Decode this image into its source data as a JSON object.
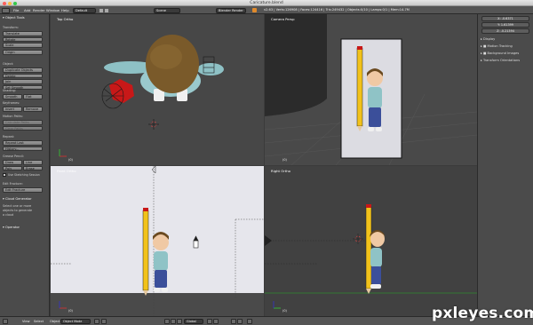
{
  "window": {
    "title": "Caricature.blend"
  },
  "info_header": {
    "menus": [
      "File",
      "Add",
      "Render",
      "Window",
      "Help"
    ],
    "layout": "Default",
    "scene": "Scene",
    "engine": "Blender Render",
    "stats": "v2.63 | Verts:126908 | Faces:124416 | Tris:249432 | Objects:0/10 | Lamps:0/1 | Mem:14.7M"
  },
  "tool_shelf": {
    "header": "Object Tools",
    "transform": {
      "title": "Transform:",
      "buttons": [
        "Translate",
        "Rotate",
        "Scale",
        "Origin"
      ]
    },
    "object": {
      "title": "Object:",
      "buttons": [
        "Duplicate Objects",
        "Delete",
        "Join",
        "Set Smooth"
      ]
    },
    "shading": {
      "title": "Shading:",
      "smooth": "Smooth",
      "flat": "Flat"
    },
    "keyframes": {
      "title": "Keyframes:",
      "insert": "Insert",
      "remove": "Remove"
    },
    "motion_paths": {
      "title": "Motion Paths:",
      "buttons": [
        "Calculate Paths",
        "Clear Paths"
      ]
    },
    "repeat": {
      "title": "Repeat:",
      "buttons": [
        "Repeat Last",
        "History..."
      ]
    },
    "grease_pencil": {
      "title": "Grease Pencil:",
      "draw": "Draw",
      "line": "Line",
      "poly": "Poly",
      "erase": "Erase",
      "checkbox": "Use Sketching Session"
    },
    "edit_fracture": {
      "title": "Edit Fracture:",
      "button": "Edit Fracture"
    },
    "cloud": {
      "title": "Cloud Generator",
      "text": [
        "Select one or more",
        "objects to generate",
        "a cloud"
      ]
    },
    "operator": "Operator"
  },
  "viewports": {
    "top_left": {
      "label": "Top Ortho",
      "num": "(0)"
    },
    "top_right": {
      "label": "Camera Persp",
      "num": "(0)"
    },
    "bottom_left": {
      "label": "Front Ortho",
      "num": "(0)"
    },
    "bottom_right": {
      "label": "Right Ortho",
      "num": "(0)"
    }
  },
  "properties": {
    "x": "X: -0.6371",
    "y": "Y: 1.61399",
    "z": "Z: -0.21394",
    "rows": [
      "Display",
      "Motion Tracking",
      "Background Images",
      "Transform Orientations"
    ]
  },
  "bottom_header": {
    "view": "View",
    "select": "Select",
    "object": "Object",
    "mode": "Object Mode",
    "pivot": "Global",
    "num_labels": [
      "(0)",
      "(0)"
    ]
  },
  "watermark": "pxleyes.com",
  "colors": {
    "viewport_bg": "#474747",
    "camera_bg": "#dcdce2",
    "front_bg": "#e6e6ec",
    "panel_bg": "#4b4b4b",
    "header_bg": "#555555",
    "pencil": "#f2c21a",
    "shirt": "#8fc3c6",
    "jeans": "#3b4f9a",
    "hair": "#7a5a2a"
  }
}
